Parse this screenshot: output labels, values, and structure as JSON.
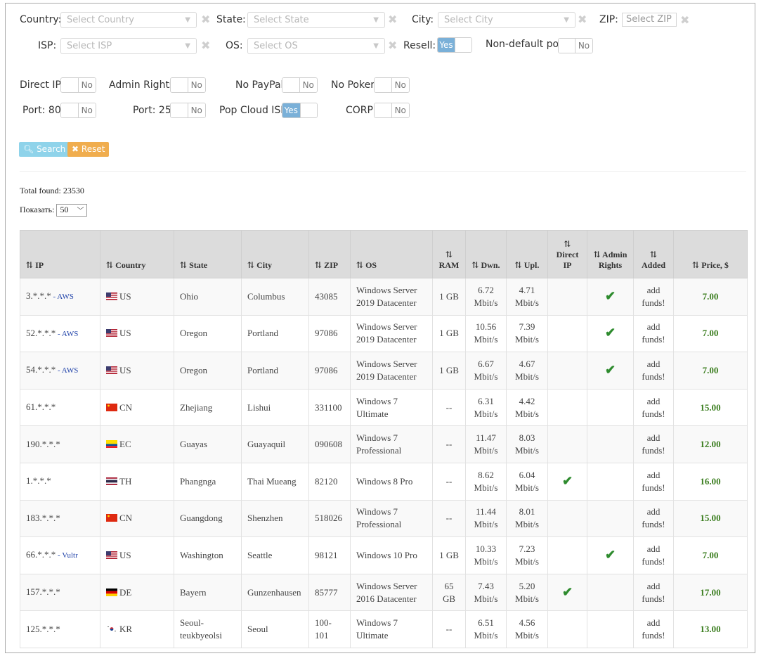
{
  "filters": {
    "country_label": "Country:",
    "country_placeholder": "Select Country",
    "state_label": "State:",
    "state_placeholder": "Select State",
    "city_label": "City:",
    "city_placeholder": "Select City",
    "zip_label": "ZIP:",
    "zip_placeholder": "Select ZIP",
    "isp_label": "ISP:",
    "isp_placeholder": "Select ISP",
    "os_label": "OS:",
    "os_placeholder": "Select OS",
    "resell_label": "Resell:",
    "resell_value": "Yes",
    "nondefault_label": "Non-default port",
    "nondefault_value": "No",
    "direct_ip_label": "Direct IP:",
    "direct_ip_value": "No",
    "admin_label": "Admin Rights:",
    "admin_value": "No",
    "nopaypal_label": "No PayPal:",
    "nopaypal_value": "No",
    "nopoker_label": "No Poker:",
    "nopoker_value": "No",
    "port80_label": "Port: 80:",
    "port80_value": "No",
    "port25_label": "Port: 25:",
    "port25_value": "No",
    "popcloud_label": "Pop Cloud ISP:",
    "popcloud_value": "Yes",
    "corp_label": "CORP:",
    "corp_value": "No"
  },
  "actions": {
    "search_label": "Search",
    "reset_label": "Reset"
  },
  "results": {
    "total_label": "Total found: 23530",
    "show_label": "Показать:",
    "per_page": "50"
  },
  "colors": {
    "toggle_yes": "#7ab0d8",
    "search_button": "#8fd3ea",
    "reset_button": "#f0ad4e",
    "price": "#3a7d1e",
    "check": "#2e8b2e"
  },
  "table": {
    "sort_icon": "⇅",
    "headers": [
      "IP",
      "Country",
      "State",
      "City",
      "ZIP",
      "OS",
      "RAM",
      "Dwn.",
      "Upl.",
      "Direct IP",
      "Admin Rights",
      "Added",
      "Price, $"
    ],
    "rows": [
      {
        "ip": "3.*.*.*",
        "isp": " - AWS",
        "flag": "us",
        "country": "US",
        "state": "Ohio",
        "city": "Columbus",
        "zip": "43085",
        "os": "Windows Server 2019 Datacenter",
        "ram": "1 GB",
        "dwn": "6.72 Mbit/s",
        "upl": "4.71 Mbit/s",
        "direct": "",
        "admin": "✔",
        "added": "add funds!",
        "price": "7.00"
      },
      {
        "ip": "52.*.*.*",
        "isp": " - AWS",
        "flag": "us",
        "country": "US",
        "state": "Oregon",
        "city": "Portland",
        "zip": "97086",
        "os": "Windows Server 2019 Datacenter",
        "ram": "1 GB",
        "dwn": "10.56 Mbit/s",
        "upl": "7.39 Mbit/s",
        "direct": "",
        "admin": "✔",
        "added": "add funds!",
        "price": "7.00"
      },
      {
        "ip": "54.*.*.*",
        "isp": " - AWS",
        "flag": "us",
        "country": "US",
        "state": "Oregon",
        "city": "Portland",
        "zip": "97086",
        "os": "Windows Server 2019 Datacenter",
        "ram": "1 GB",
        "dwn": "6.67 Mbit/s",
        "upl": "4.67 Mbit/s",
        "direct": "",
        "admin": "✔",
        "added": "add funds!",
        "price": "7.00"
      },
      {
        "ip": "61.*.*.*",
        "isp": "",
        "flag": "cn",
        "country": "CN",
        "state": "Zhejiang",
        "city": "Lishui",
        "zip": "331100",
        "os": "Windows 7 Ultimate",
        "ram": "--",
        "dwn": "6.31 Mbit/s",
        "upl": "4.42 Mbit/s",
        "direct": "",
        "admin": "",
        "added": "add funds!",
        "price": "15.00"
      },
      {
        "ip": "190.*.*.*",
        "isp": "",
        "flag": "ec",
        "country": "EC",
        "state": "Guayas",
        "city": "Guayaquil",
        "zip": "090608",
        "os": "Windows 7 Professional",
        "ram": "--",
        "dwn": "11.47 Mbit/s",
        "upl": "8.03 Mbit/s",
        "direct": "",
        "admin": "",
        "added": "add funds!",
        "price": "12.00"
      },
      {
        "ip": "1.*.*.*",
        "isp": "",
        "flag": "th",
        "country": "TH",
        "state": "Phangnga",
        "city": "Thai Mueang",
        "zip": "82120",
        "os": "Windows 8 Pro",
        "ram": "--",
        "dwn": "8.62 Mbit/s",
        "upl": "6.04 Mbit/s",
        "direct": "✔",
        "admin": "",
        "added": "add funds!",
        "price": "16.00"
      },
      {
        "ip": "183.*.*.*",
        "isp": "",
        "flag": "cn",
        "country": "CN",
        "state": "Guangdong",
        "city": "Shenzhen",
        "zip": "518026",
        "os": "Windows 7 Professional",
        "ram": "--",
        "dwn": "11.44 Mbit/s",
        "upl": "8.01 Mbit/s",
        "direct": "",
        "admin": "",
        "added": "add funds!",
        "price": "15.00"
      },
      {
        "ip": "66.*.*.*",
        "isp": " - Vultr",
        "flag": "us",
        "country": "US",
        "state": "Washington",
        "city": "Seattle",
        "zip": "98121",
        "os": "Windows 10 Pro",
        "ram": "1 GB",
        "dwn": "10.33 Mbit/s",
        "upl": "7.23 Mbit/s",
        "direct": "",
        "admin": "✔",
        "added": "add funds!",
        "price": "7.00"
      },
      {
        "ip": "157.*.*.*",
        "isp": "",
        "flag": "de",
        "country": "DE",
        "state": "Bayern",
        "city": "Gunzenhausen",
        "zip": "85777",
        "os": "Windows Server 2016 Datacenter",
        "ram": "65 GB",
        "dwn": "7.43 Mbit/s",
        "upl": "5.20 Mbit/s",
        "direct": "✔",
        "admin": "",
        "added": "add funds!",
        "price": "17.00"
      },
      {
        "ip": "125.*.*.*",
        "isp": "",
        "flag": "kr",
        "country": "KR",
        "state": "Seoul-teukbyeolsi",
        "city": "Seoul",
        "zip": "100-101",
        "os": "Windows 7 Ultimate",
        "ram": "--",
        "dwn": "6.51 Mbit/s",
        "upl": "4.56 Mbit/s",
        "direct": "",
        "admin": "",
        "added": "add funds!",
        "price": "13.00"
      }
    ]
  }
}
